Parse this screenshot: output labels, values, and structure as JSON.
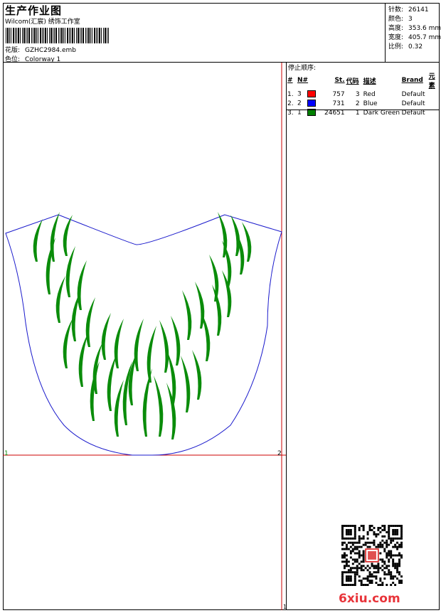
{
  "header": {
    "title": "生产作业图",
    "studio": "Wilcom(汇宸) 绣饰工作室",
    "pattern_label": "花版:",
    "pattern_value": "GZHC2984.emb",
    "color_label": "色位:",
    "color_value": "Colorway 1"
  },
  "stats": [
    {
      "label": "针数:",
      "value": "26141"
    },
    {
      "label": "颜色:",
      "value": "3"
    },
    {
      "label": "高度:",
      "value": "353.6 mm"
    },
    {
      "label": "宽度:",
      "value": "405.7 mm"
    },
    {
      "label": "比例:",
      "value": "0.32"
    }
  ],
  "stop_sequence": {
    "title": "停止顺序:",
    "columns": [
      "#",
      "N#",
      "St.",
      "代码",
      "描述",
      "Brand",
      "元素"
    ],
    "rows": [
      {
        "idx": "1.",
        "n": "3",
        "color": "#ff0000",
        "st": "757",
        "code": "3",
        "desc": "Red",
        "brand": "Default"
      },
      {
        "idx": "2.",
        "n": "2",
        "color": "#0000ff",
        "st": "731",
        "code": "2",
        "desc": "Blue",
        "brand": "Default"
      },
      {
        "idx": "3.",
        "n": "1",
        "color": "#008000",
        "st": "24651",
        "code": "1",
        "desc": "Dark Green",
        "brand": "Default"
      }
    ]
  },
  "design": {
    "start_marker": "1",
    "end_marker": "2",
    "bottom_marker": "1",
    "outline_color": "#1a1acc",
    "fill_color": "#0a8c0a",
    "guide_color": "#cc0000"
  },
  "watermark": "6xiu.com"
}
